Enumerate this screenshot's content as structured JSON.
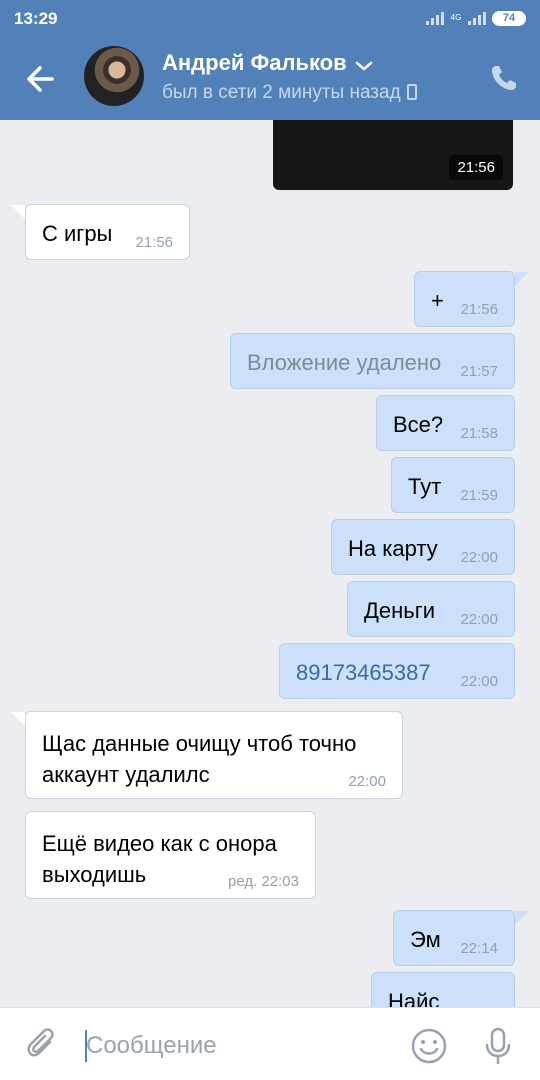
{
  "status_bar": {
    "time": "13:29",
    "network": "4G",
    "battery": "74"
  },
  "header": {
    "contact_name": "Андрей Фальков",
    "contact_status": "был в сети 2 минуты назад"
  },
  "video": {
    "time": "21:56"
  },
  "messages": [
    {
      "text": "С игры",
      "time": "21:56"
    },
    {
      "text": "+",
      "time": "21:56"
    },
    {
      "text": "Вложение удалено",
      "time": "21:57"
    },
    {
      "text": "Все?",
      "time": "21:58"
    },
    {
      "text": "Тут",
      "time": "21:59"
    },
    {
      "text": "На карту",
      "time": "22:00"
    },
    {
      "text": "Деньги",
      "time": "22:00"
    },
    {
      "text": "89173465387",
      "time": "22:00"
    },
    {
      "text": "Щас данные очищу чтоб точно аккаунт удалилс",
      "time": "22:00"
    },
    {
      "text": "Ещё видео как с онора выходишь",
      "time": "ред. 22:03"
    },
    {
      "text": "Эм",
      "time": "22:14"
    },
    {
      "text": "Найс",
      "time": ""
    }
  ],
  "composer": {
    "placeholder": "Сообщение"
  },
  "colors": {
    "header": "#5181b8",
    "outgoing_bubble": "#cce0fa",
    "incoming_bubble": "#ffffff",
    "background": "#ebedf0"
  }
}
